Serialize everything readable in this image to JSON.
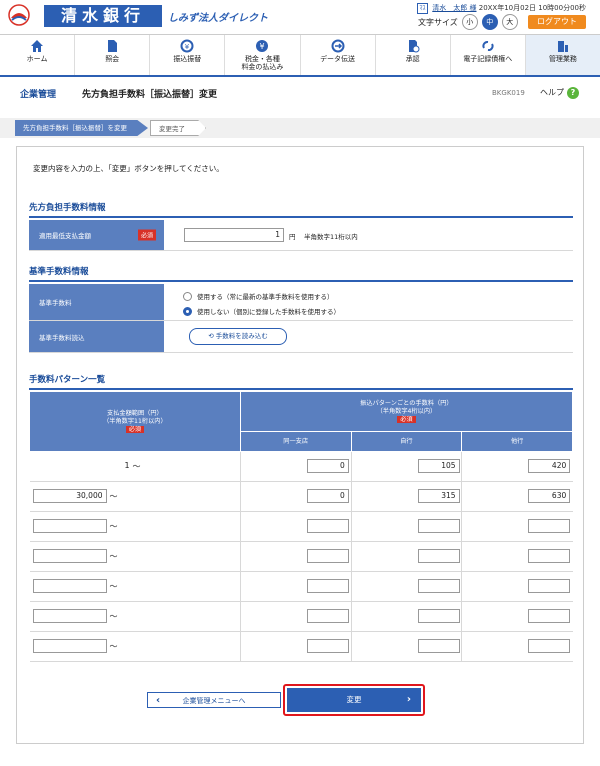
{
  "header": {
    "bank_name": "清水銀行",
    "sub_brand": "しみず法人ダイレクト",
    "user_icon": "ﾏｽ",
    "user_name": "清水　太郎 様",
    "last_login": "20XX年10月02日 10時00分00秒",
    "font_size_label": "文字サイズ",
    "font_sizes": [
      "小",
      "中",
      "大"
    ],
    "font_size_selected": "中",
    "logout": "ログアウト"
  },
  "nav": [
    {
      "label": "ホーム",
      "icon": "home-icon"
    },
    {
      "label": "照会",
      "icon": "document-icon"
    },
    {
      "label": "振込振替",
      "icon": "transfer-icon"
    },
    {
      "label": "税金・各種\n料金の払込み",
      "icon": "yen-icon"
    },
    {
      "label": "データ伝送",
      "icon": "data-transfer-icon"
    },
    {
      "label": "承認",
      "icon": "approval-icon"
    },
    {
      "label": "電子記録債権へ",
      "icon": "link-icon"
    },
    {
      "label": "管理業務",
      "icon": "management-icon",
      "active": true
    }
  ],
  "title_bar": {
    "section": "企業管理",
    "page_title": "先方負担手数料［振込振替］変更",
    "screen_id": "BKGK019",
    "help": "ヘルプ",
    "help_icon": "?"
  },
  "steps": [
    "先方負担手数料［振込振替］を変更",
    "変更完了"
  ],
  "instruction": "変更内容を入力の上、「変更」ボタンを押してください。",
  "section1": {
    "title": "先方負担手数料情報",
    "label": "適用最低支払金額",
    "required": "必須",
    "value": "1",
    "unit": "円",
    "note": "半角数字11桁以内"
  },
  "section2": {
    "title": "基準手数料情報",
    "label_fee": "基準手数料",
    "options": [
      {
        "label": "使用する（常に最新の基準手数料を使用する）",
        "selected": false
      },
      {
        "label": "使用しない（個別に登録した手数料を使用する）",
        "selected": true
      }
    ],
    "label_load": "基準手数料読込",
    "load_button": "手数料を読み込む"
  },
  "section3": {
    "title": "手数料パターン一覧",
    "col_range": "支払金額範囲（円）",
    "col_range_note": "（半角数字11桁以内）",
    "col_fee": "振込パターンごとの手数料（円）",
    "col_fee_note": "（半角数字4桁以内）",
    "required": "必須",
    "sub_cols": [
      "同一支店",
      "自行",
      "他行"
    ],
    "tilde": "～",
    "rows": [
      {
        "from": "1",
        "fixed": true,
        "same_branch": "0",
        "own_bank": "105",
        "other_bank": "420"
      },
      {
        "from": "30,000",
        "fixed": false,
        "same_branch": "0",
        "own_bank": "315",
        "other_bank": "630"
      },
      {
        "from": "",
        "fixed": false,
        "same_branch": "",
        "own_bank": "",
        "other_bank": ""
      },
      {
        "from": "",
        "fixed": false,
        "same_branch": "",
        "own_bank": "",
        "other_bank": ""
      },
      {
        "from": "",
        "fixed": false,
        "same_branch": "",
        "own_bank": "",
        "other_bank": ""
      },
      {
        "from": "",
        "fixed": false,
        "same_branch": "",
        "own_bank": "",
        "other_bank": ""
      },
      {
        "from": "",
        "fixed": false,
        "same_branch": "",
        "own_bank": "",
        "other_bank": ""
      }
    ]
  },
  "buttons": {
    "back": "企業管理メニューへ",
    "change": "変更"
  },
  "colors": {
    "brand_blue": "#2c5fb3",
    "header_cell": "#5a7fbf",
    "logout_orange": "#f08a1e",
    "required_red": "#d83127",
    "highlight_red": "#e0161c"
  }
}
